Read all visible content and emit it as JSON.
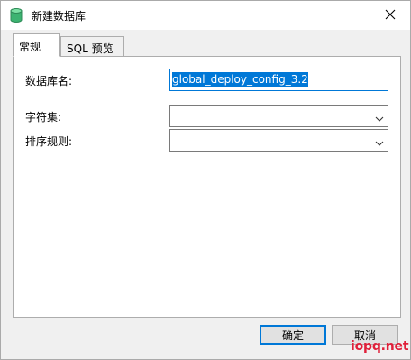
{
  "window": {
    "title": "新建数据库",
    "app_icon": "database-icon",
    "close_icon": "close-icon"
  },
  "tabs": [
    {
      "label": "常规",
      "active": true
    },
    {
      "label": "SQL 预览",
      "active": false
    }
  ],
  "form": {
    "name_label": "数据库名:",
    "name_value": "global_deploy_config_3.2",
    "charset_label": "字符集:",
    "charset_value": "",
    "collation_label": "排序规则:",
    "collation_value": ""
  },
  "buttons": {
    "ok_label": "确定",
    "cancel_label": "取消"
  },
  "watermark": {
    "text": "iopq.net"
  },
  "colors": {
    "accent": "#0078d7",
    "db_icon_green": "#3cb371",
    "watermark": "#e0203a"
  }
}
